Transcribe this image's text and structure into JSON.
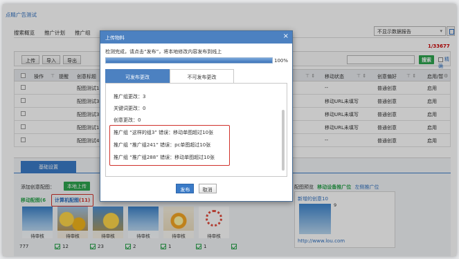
{
  "app_title": "点睛广告测试",
  "nav": [
    "搜索概览",
    "推广计划",
    "推广组"
  ],
  "report_select": "不显示数据报告",
  "count": "1/33677",
  "toolbar": {
    "upload": "上传",
    "import": "导入",
    "export": "导出",
    "search": "搜索",
    "precise": "精确"
  },
  "table": {
    "headers": [
      "操作",
      "提醒",
      "创意标题",
      "移动状态",
      "创意偏好",
      "启用/暂"
    ],
    "rows": [
      {
        "title": "配图测试1",
        "mobile": "--",
        "pref": "普通创意",
        "status": "启用"
      },
      {
        "title": "配图测试3",
        "mobile": "移动URL未填写",
        "pref": "普通创意",
        "status": "启用"
      },
      {
        "title": "配图测试3",
        "mobile": "移动URL未填写",
        "pref": "普通创意",
        "status": "启用"
      },
      {
        "title": "配图测试1",
        "mobile": "移动URL未填写",
        "pref": "普通创意",
        "status": "启用"
      },
      {
        "title": "配图测试4",
        "mobile": "--",
        "pref": "普通创意",
        "status": "启用"
      }
    ]
  },
  "bottom": {
    "tab": "基础设置",
    "add_label": "添加创意配图：",
    "local_upload": "本地上传",
    "mobile_cfg": "移动配图(6",
    "pc_cfg_label": "计算机配图",
    "pc_cfg_count": "(11)",
    "thumb_tag": "待审核",
    "stats": [
      "777",
      "12",
      "23",
      "2",
      "1",
      "1"
    ],
    "preview_label": "配图预览",
    "preview_green": "移动设备推广位",
    "preview_blue": "左侧推广位",
    "preview_title": "新增的创意10",
    "preview_num": "9",
    "preview_url": "http://www.lou.com"
  },
  "dialog": {
    "title": "上传物料",
    "message": "检测完成，请点击“发布”，将本地修改内容发布到线上",
    "progress": 100,
    "progress_text": "100%",
    "tab_publishable": "可发布更改",
    "tab_unpublishable": "不可发布更改",
    "lines": [
      "推广组更改：3",
      "关键词更改：0",
      "创意更改：0"
    ],
    "errors": [
      "推广组 “这样的组3” 错误：移动单图超过10张",
      "推广组 “推广组241” 错误：pc单图超过10张",
      "推广组 “推广组288” 错误：移动单图超过10张"
    ],
    "publish": "发布",
    "cancel": "取消"
  }
}
